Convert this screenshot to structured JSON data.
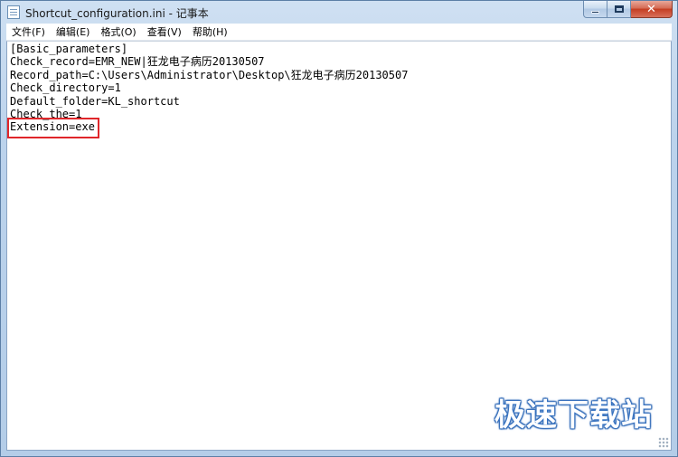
{
  "window": {
    "title": "Shortcut_configuration.ini - 记事本",
    "minimize_label": "",
    "maximize_label": "",
    "close_label": "✕"
  },
  "icons": {
    "app": "notepad-icon",
    "minimize": "minimize-icon",
    "maximize": "maximize-icon",
    "close": "close-icon"
  },
  "menu": [
    {
      "label": "文件(F)"
    },
    {
      "label": "编辑(E)"
    },
    {
      "label": "格式(O)"
    },
    {
      "label": "查看(V)"
    },
    {
      "label": "帮助(H)"
    }
  ],
  "document": {
    "lines": [
      "[Basic_parameters]",
      "Check_record=EMR_NEW|狂龙电子病历20130507",
      "Record_path=C:\\Users\\Administrator\\Desktop\\狂龙电子病历20130507",
      "Check_directory=1",
      "Default_folder=KL_shortcut",
      "Check_the=1",
      "Extension=exe"
    ]
  },
  "annotation": {
    "highlight_color": "#e0262a"
  },
  "watermark": {
    "text": "极速下载站"
  }
}
